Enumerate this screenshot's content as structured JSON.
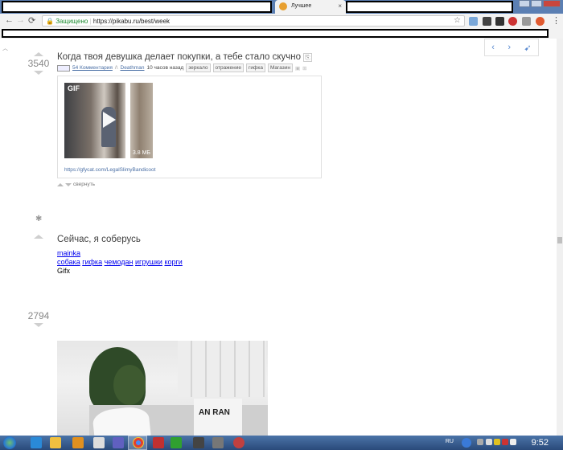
{
  "browser": {
    "tab_title": "Лучшее",
    "tab_close": "×",
    "secure_label": "Защищено",
    "url": "https://pikabu.ru/best/week",
    "back": "←",
    "forward": "→",
    "reload": "⟳"
  },
  "post1": {
    "rating": "3540",
    "title": "Когда твоя девушка делает покупки, а тебе стало скучно",
    "comments": "54 Комментария",
    "author": "Deathman",
    "time": "10 часов назад",
    "tags": [
      "зеркало",
      "отражение",
      "гифка",
      "Магазин"
    ],
    "gif_label": "GIF",
    "gif_size": "3.8 МБ",
    "gif_url": "https://gfycat.com/LegalSlimyBandicoot",
    "collapse": "свернуть"
  },
  "post2": {
    "title": "Сейчас, я соберусь",
    "author": "mainka",
    "tags": [
      "собака",
      "гифка",
      "чемодан",
      "игрушки",
      "корги"
    ],
    "format": "Gifx"
  },
  "post3": {
    "rating": "2794",
    "pillow_text": "AN RAN"
  },
  "taskbar": {
    "lang": "RU",
    "time": "9:52"
  },
  "colors": {
    "link": "#4a6fa5",
    "secure": "#1a8a2e",
    "taskbar": "#2a4a7a"
  }
}
